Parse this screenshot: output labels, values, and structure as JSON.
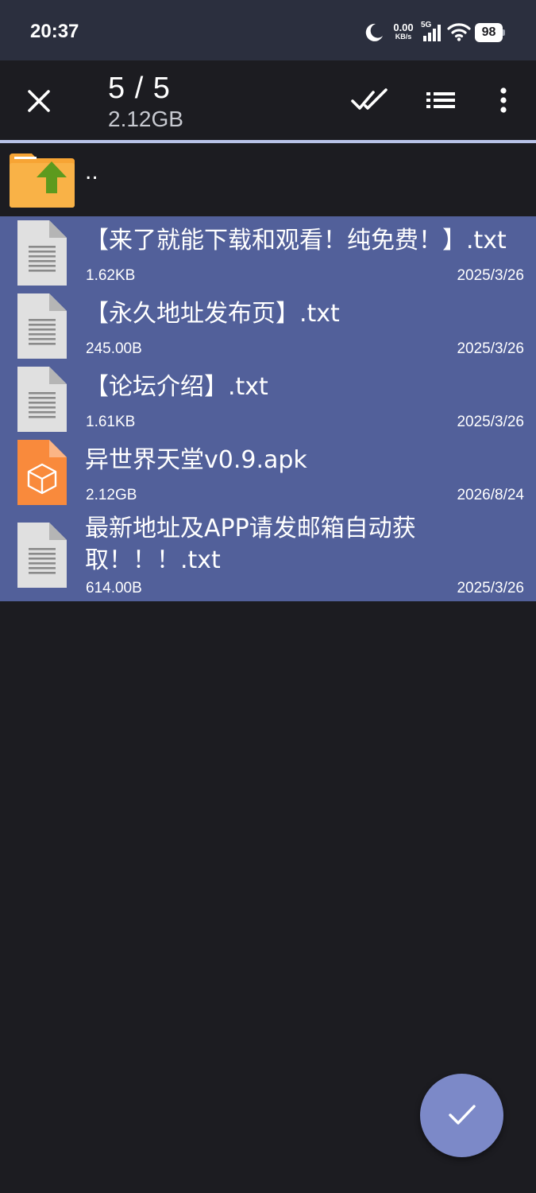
{
  "status_bar": {
    "time": "20:37",
    "net_speed_value": "0.00",
    "net_speed_unit": "KB/s",
    "network_type": "5G",
    "battery": "98",
    "icons": [
      "moon-icon",
      "signal-icon",
      "wifi-icon",
      "battery-icon"
    ]
  },
  "toolbar": {
    "selection_count": "5 / 5",
    "selection_size": "2.12GB",
    "icons": [
      "close-icon",
      "select-all-icon",
      "list-view-icon",
      "more-vert-icon"
    ]
  },
  "parent_dir": {
    "label": "..",
    "icon": "folder-up-icon"
  },
  "files": [
    {
      "name": "【来了就能下载和观看！纯免费！】.txt",
      "size": "1.62KB",
      "date": "2025/3/26",
      "icon": "text-file-icon",
      "selected": true
    },
    {
      "name": "【永久地址发布页】.txt",
      "size": "245.00B",
      "date": "2025/3/26",
      "icon": "text-file-icon",
      "selected": true
    },
    {
      "name": "【论坛介绍】.txt",
      "size": "1.61KB",
      "date": "2025/3/26",
      "icon": "text-file-icon",
      "selected": true
    },
    {
      "name": "异世界天堂v0.9.apk",
      "size": "2.12GB",
      "date": "2026/8/24",
      "icon": "apk-file-icon",
      "selected": true
    },
    {
      "name": "最新地址及APP请发邮箱自动获取！！！.txt",
      "size": "614.00B",
      "date": "2025/3/26",
      "icon": "text-file-icon",
      "selected": true
    }
  ],
  "fab": {
    "icon": "check-icon"
  },
  "colors": {
    "background": "#1c1c21",
    "status_bar": "#2b2f3e",
    "selected_row": "#52609a",
    "accent_line": "#b8c3e8",
    "fab": "#7c89c8",
    "folder": "#f7a434",
    "apk": "#f98a3c"
  }
}
